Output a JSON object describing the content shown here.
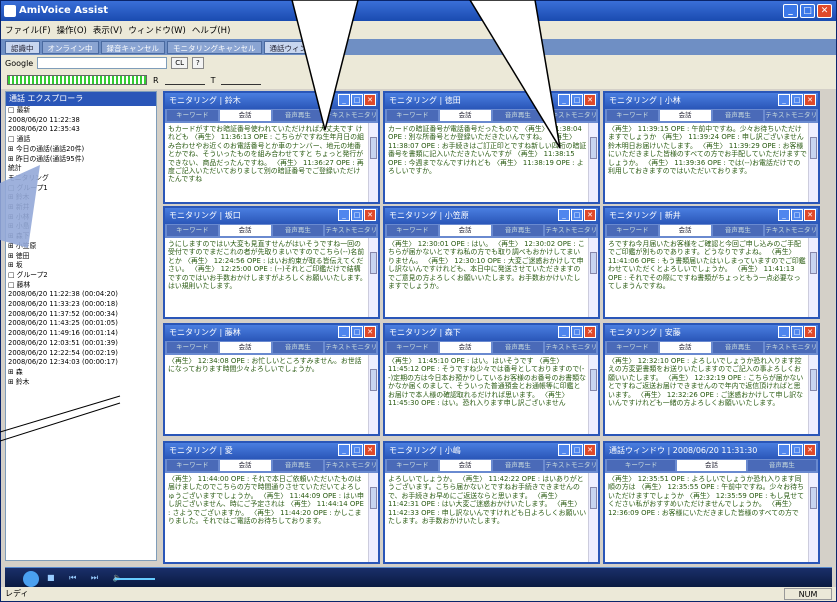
{
  "app": {
    "title": "AmiVoice Assist",
    "win_buttons": [
      "_",
      "□",
      "✕"
    ]
  },
  "menu": [
    "ファイル(F)",
    "操作(O)",
    "表示(V)",
    "ウィンドウ(W)",
    "ヘルプ(H)"
  ],
  "toolbar1": [
    "認識中",
    "オンライン中",
    "録音キャンセル",
    "モニタリングキャンセル",
    "通話ウィンドウ"
  ],
  "toolbar2": {
    "google": "Google",
    "cl": "CL",
    "q": "?"
  },
  "toolbar3": {
    "r": "R",
    "t": "T"
  },
  "explorer": {
    "title": "通話 エクスプローラ",
    "items": [
      "□ 最新",
      "  2008/06/20 11:22:38",
      "  2008/06/20 12:35:43",
      "□ 通話",
      "  ⊞ 今日の通話(通話20件)",
      "  ⊞ 昨日の通話(通話95件)",
      "  統計",
      "  モニタリング",
      "  □ グループ1",
      "    ⊞ 鈴木",
      "    ⊞ 新井",
      "    ⊞ 小林",
      "    ⊞ 小島",
      "    ⊞ 森下",
      "    ⊞ 小笠原",
      "    ⊞ 徳田",
      "    ⊞ 坂",
      "  □ グループ2",
      "    □ 藤林",
      "      2008/06/20 11:22:38 (00:04:20)",
      "      2008/06/20 11:33:23 (00:00:18)",
      "      2008/06/20 11:37:52 (00:00:34)",
      "      2008/06/20 11:43:25 (00:01:05)",
      "      2008/06/20 11:49:16 (00:01:14)",
      "      2008/06/20 12:03:51 (00:01:39)",
      "      2008/06/20 12:22:54 (00:02:19)",
      "      2008/06/20 12:34:03 (00:00:17)",
      "    ⊞ 森",
      "    ⊞ 鈴木"
    ]
  },
  "panels": [
    {
      "title": "モニタリング | 鈴木",
      "tabs": [
        "キーワード",
        "会話",
        "音声再生",
        "テキストモニタリング"
      ],
      "text": "もカードがすでお暗証番号使われていただければ大丈夫です けれども 〈再生〉 11:36:13 OPE : こちらがですね生年月日の組み合わせやお近くのお電話番号とか車のナンバー、地元の地番とかでね、そういったものを組み合わせてすと ちょっと発行ができない、商品だったんですね。 〈再生〉 11:36:27 OPE : 再度ご記入いただいておりまして別の暗証番号でご登録いただけたんですね"
    },
    {
      "title": "モニタリング | 徳田",
      "tabs": [
        "キーワード",
        "会話",
        "音声再生",
        "テキストモニタリング"
      ],
      "text": "カードの暗証番号が電話番号だったもので 〈再生〉 11:38:04 OPE : 別な所番号とか登録いただきたいんですね。 〈再生〉 11:38:07 OPE : お手続きはご訂正印とですね新しい四桁の暗証番号を書類に記入いただきたいんですが 〈再生〉 11:38:15 OPE : 今週までなんですけれども 〈再生〉 11:38:19 OPE : よろしいですか。"
    },
    {
      "title": "モニタリング | 小林",
      "tabs": [
        "キーワード",
        "会話",
        "音声再生",
        "テキストモニタリング"
      ],
      "text": "〈再生〉 11:39:15 OPE : 午前中ですね。少々お待ちいただけますでしょうか 〈再生〉 11:39:24 OPE : 申し訳ございません鈴木明日お届けいたします。 〈再生〉 11:39:29 OPE : お客様にいただきました皆様のすべての方でお手配していただけますでしょうか。 〈再生〉 11:39:36 OPE : では(--)お電話だけでの利用しておきますのではいただいております。"
    },
    {
      "title": "モニタリング | 坂口",
      "tabs": [
        "キーワード",
        "会話",
        "音声再生",
        "テキストモニタリング"
      ],
      "text": "うにしますのではい大変も見直すせんがはいそうですね一回の受付ですのでまだこれの者が先取りまいですのでこちら(--)名前とか 〈再生〉 12:24:56 OPE : はいお約束が取る皆伝えてください。 〈再生〉 12:25:00 OPE : (--)それとご印鑑だけで結構ですのではいお手数おかけしますがよろしくお願いいたします。はい規則いたします。"
    },
    {
      "title": "モニタリング | 小笠原",
      "tabs": [
        "キーワード",
        "会話",
        "音声再生",
        "テキストモニタリング"
      ],
      "text": "〈再生〉 12:30:01 OPE : はい。 〈再生〉 12:30:02 OPE : こちらが届かないとですね私の方でも取り調べもおかけしてまいりません。 〈再生〉 12:30:10 OPE : 大変ご迷惑おかけして申し訳ないんですけれども、本日中に発送させていただきますのでご意見の方よろしくお願いいたします。お手数おかけいたしますでしょうか。"
    },
    {
      "title": "モニタリング | 新井",
      "tabs": [
        "キーワード",
        "会話",
        "音声再生",
        "テキストモニタリング"
      ],
      "text": "ろですね今月届いたお客様をご確認と今回ご申し込みのご手配でご印鑑が別ものであります。どうなりですよね。 〈再生〉 11:41:06 OPE : もう書類届いたはいしまっていますのでご印鑑わせていただくとよろしいでしょうか。 〈再生〉 11:41:13 OPE : それでその際にですね書類がちょっともう一点必要なってしまうんですね。"
    },
    {
      "title": "モニタリング | 藤林",
      "tabs": [
        "キーワード",
        "会話",
        "音声再生",
        "テキストモニタリング"
      ],
      "text": "〈再生〉 12:34:08 OPE : お忙しいところすみません。お世話になっております時間少々よろしいでしょうか。"
    },
    {
      "title": "モニタリング | 森下",
      "tabs": [
        "キーワード",
        "会話",
        "音声再生",
        "テキストモニタリング"
      ],
      "text": "〈再生〉 11:45:10 OPE : はい。はいそうです 〈再生〉 11:45:12 OPE : そうですね少々では番号としておりますので(--)定期の方は今日本お預かりしているお客様のお番号のお書類なかなか届くのまして、そういった普通預金とお通帳等に印鑑とお届けで本人様の確認取れるだければ思います。 〈再生〉 11:45:30 OPE : はい。恐れ入ります申し訳ございません"
    },
    {
      "title": "モニタリング | 安藤",
      "tabs": [
        "キーワード",
        "会話",
        "音声再生",
        "テキストモニタリング"
      ],
      "text": "〈再生〉 12:32:10 OPE : よろしいでしょうか恐れ入ります控えの方変更書類をお送りいたしますのでご記入の事よろしくお願いいたします。 〈再生〉 12:32:19 OPE : こちらが届かないとですねご返送お届けできませんので年内で返信頂ければと思います。 〈再生〉 12:32:26 OPE : ご迷惑おかけして申し訳ないんですけれども一緒の方よろしくお願いいたします。"
    },
    {
      "title": "モニタリング | 愛",
      "tabs": [
        "キーワード",
        "会話",
        "音声再生",
        "テキストモニタリング"
      ],
      "text": "〈再生〉 11:44:00 OPE : それで本日ご依頼いただいたものは届けましたのでこちらの方で時間通りさせていただいてよろしゅうございますでしょうか。 〈再生〉 11:44:09 OPE : はい申し訳ございません、時にご予定されは 〈再生〉 11:44:14 OPE : さようでございますか。 〈再生〉 11:44:20 OPE : かしこまりました。それではご電話のお待ちしております。"
    },
    {
      "title": "モニタリング | 小嶋",
      "tabs": [
        "キーワード",
        "会話",
        "音声再生",
        "テキストモニタリング"
      ],
      "text": "よろしいでしょうか。 〈再生〉 11:42:22 OPE : はいありがとうございます。こちら届かないとですねお手続きできませんので、お手続きお早めにご返送ならと思います。 〈再生〉 11:42:31 OPE : はい大変ご迷惑おかけいたします。 〈再生〉 11:42:33 OPE : 申し訳ないんですけれども日よろしくお願いいたします。お手数おかけいたします。"
    },
    {
      "title": "通話ウィンドウ | 2008/06/20 11:31:30",
      "tabs": [
        "キーワード",
        "会話",
        "音声再生"
      ],
      "text": "〈再生〉 12:35:51 OPE : よろしいでしょうか恐れ入ります同順の方は 〈再生〉 12:35:55 OPE : 午前中ですね。少々お待ちいただけますでしょうか 〈再生〉 12:35:59 OPE : もし見せてください私がおすすめいただけませんでしょうか。 〈再生〉 12:36:09 OPE : お客様にいただきました皆様のすべての方で"
    }
  ],
  "status": {
    "left": "レディ",
    "right": "NUM"
  }
}
